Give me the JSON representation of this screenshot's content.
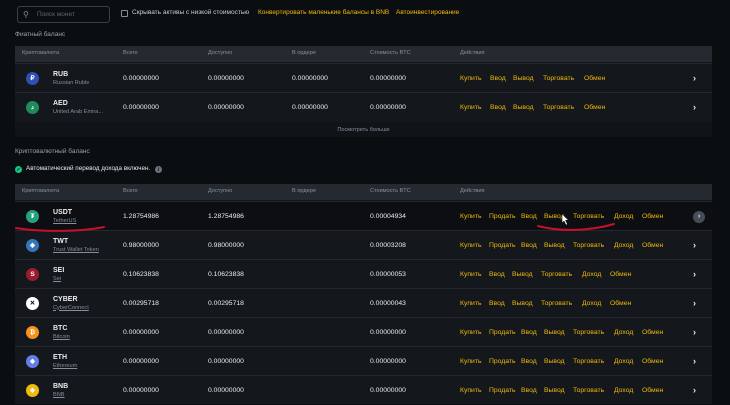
{
  "toolbar": {
    "search_placeholder": "Поиск монет",
    "search_icon": "search-icon",
    "hide_small_label": "Скрывать активы с низкой стоимостью",
    "convert_label": "Конвертировать маленькие балансы в BNB",
    "auto_invest_label": "Автоинвестирование"
  },
  "fiat": {
    "title": "Фиатный баланс",
    "headers": [
      "Криптовалюта",
      "Всего",
      "Доступно",
      "В ордере",
      "Стоимость BTC",
      "Действия"
    ],
    "rows": [
      {
        "symbol": "RUB",
        "name": "Russian Ruble",
        "total": "0.00000000",
        "available": "0.00000000",
        "in_order": "0.00000000",
        "btc": "0.00000000",
        "icon": "ruble-icon",
        "color": "#2f4fb5"
      },
      {
        "symbol": "AED",
        "name": "United Arab Emira...",
        "total": "0.00000000",
        "available": "0.00000000",
        "in_order": "0.00000000",
        "btc": "0.00000000",
        "icon": "dirham-icon",
        "color": "#1f8a5a"
      }
    ],
    "actions": [
      "Купить",
      "Ввод",
      "Вывод",
      "Торговать",
      "Обмен"
    ],
    "show_more": "Посмотреть больше"
  },
  "crypto": {
    "title": "Криптовалютный баланс",
    "auto_transfer_label": "Автоматический перевод дохода включен.",
    "headers": [
      "Криптовалюта",
      "Всего",
      "Доступно",
      "В ордере",
      "Стоимость BTC",
      "Действия"
    ],
    "rows": [
      {
        "symbol": "USDT",
        "name": "TetherUS",
        "total": "1.28754986",
        "available": "1.28754986",
        "in_order": "",
        "btc": "0.00004934",
        "icon": "tether-icon",
        "color": "#26a17b",
        "actions": [
          "Купить",
          "Продать",
          "Ввод",
          "Вывод",
          "Торговать",
          "Доход",
          "Обмен"
        ]
      },
      {
        "symbol": "TWT",
        "name": "Trust Wallet Token",
        "total": "0.98000000",
        "available": "0.98000000",
        "in_order": "",
        "btc": "0.00003208",
        "icon": "shield-icon",
        "color": "#3375bb",
        "actions": [
          "Купить",
          "Продать",
          "Ввод",
          "Вывод",
          "Торговать",
          "Доход",
          "Обмен"
        ]
      },
      {
        "symbol": "SEI",
        "name": "Sei",
        "total": "0.10623838",
        "available": "0.10623838",
        "in_order": "",
        "btc": "0.00000053",
        "icon": "sei-icon",
        "color": "#9b1c2e",
        "actions": [
          "Купить",
          "Ввод",
          "Вывод",
          "Торговать",
          "Доход",
          "Обмен"
        ]
      },
      {
        "symbol": "CYBER",
        "name": "CyberConnect",
        "total": "0.00295718",
        "available": "0.00295718",
        "in_order": "",
        "btc": "0.00000043",
        "icon": "cyber-icon",
        "color": "#ffffff",
        "actions": [
          "Купить",
          "Ввод",
          "Вывод",
          "Торговать",
          "Доход",
          "Обмен"
        ]
      },
      {
        "symbol": "BTC",
        "name": "Bitcoin",
        "total": "0.00000000",
        "available": "0.00000000",
        "in_order": "",
        "btc": "0.00000000",
        "icon": "bitcoin-icon",
        "color": "#f7931a",
        "actions": [
          "Купить",
          "Продать",
          "Ввод",
          "Вывод",
          "Торговать",
          "Доход",
          "Обмен"
        ]
      },
      {
        "symbol": "ETH",
        "name": "Ethereum",
        "total": "0.00000000",
        "available": "0.00000000",
        "in_order": "",
        "btc": "0.00000000",
        "icon": "ethereum-icon",
        "color": "#627eea",
        "actions": [
          "Купить",
          "Продать",
          "Ввод",
          "Вывод",
          "Торговать",
          "Доход",
          "Обмен"
        ]
      },
      {
        "symbol": "BNB",
        "name": "BNB",
        "total": "0.00000000",
        "available": "0.00000000",
        "in_order": "",
        "btc": "0.00000000",
        "icon": "bnb-icon",
        "color": "#f0b90b",
        "actions": [
          "Купить",
          "Продать",
          "Ввод",
          "Вывод",
          "Торговать",
          "Доход",
          "Обмен"
        ]
      }
    ]
  },
  "colors": {
    "accent": "#f0b90b",
    "annotation": "#c8102e",
    "success": "#0ecb81"
  }
}
